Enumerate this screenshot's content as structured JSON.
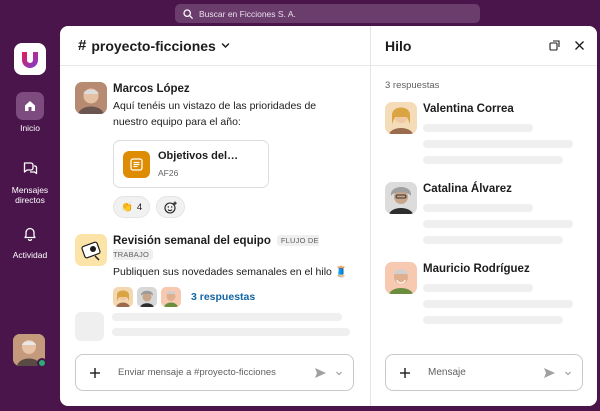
{
  "search": {
    "placeholder": "Buscar en Ficciones S. A."
  },
  "rail": {
    "items": [
      {
        "label": "Inicio",
        "icon": "home-icon"
      },
      {
        "label": "Mensajes directos",
        "icon": "messages-icon"
      },
      {
        "label": "Actividad",
        "icon": "bell-icon"
      }
    ]
  },
  "channel": {
    "name": "proyecto-ficciones"
  },
  "messages": [
    {
      "author": "Marcos López",
      "text": "Aquí tenéis un vistazo de las prioridades de nuestro equipo para el año:",
      "file": {
        "title": "Objetivos del…",
        "subtitle": "AF26"
      },
      "reactions": [
        {
          "emoji": "👏",
          "count": "4"
        }
      ]
    },
    {
      "author": "Revisión semanal del equipo",
      "tag": "FLUJO DE TRABAJO",
      "text": "Publiquen sus novedades semanales en el hilo 🧵",
      "replies": "3 respuestas"
    }
  ],
  "composer": {
    "placeholder": "Enviar mensaje a #proyecto-ficciones"
  },
  "thread": {
    "title": "Hilo",
    "reply_count": "3 respuestas",
    "replies": [
      {
        "author": "Valentina Correa"
      },
      {
        "author": "Catalina Álvarez"
      },
      {
        "author": "Mauricio Rodríguez"
      }
    ],
    "composer_placeholder": "Mensaje"
  },
  "colors": {
    "aubergine": "#4a154b",
    "link": "#1264a3",
    "file_icon": "#de8c04",
    "presence": "#2bac76"
  }
}
